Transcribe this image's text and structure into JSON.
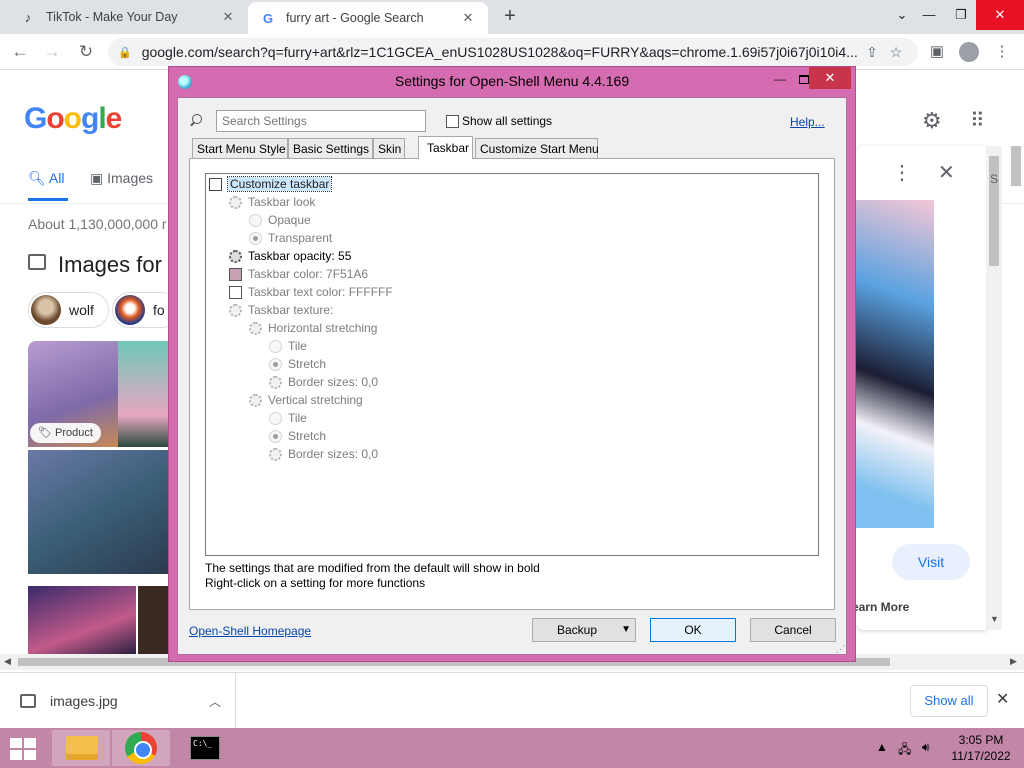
{
  "browser": {
    "tabs": [
      {
        "title": "TikTok - Make Your Day",
        "favicon": "tiktok-icon"
      },
      {
        "title": "furry art - Google Search",
        "favicon": "google-icon"
      }
    ],
    "url": "google.com/search?q=furry+art&rlz=1C1GCEA_enUS1028US1028&oq=FURRY&aqs=chrome.1.69i57j0i67j0i10i4..."
  },
  "google": {
    "logo": "Google",
    "tab_all": "All",
    "tab_images": "Images",
    "result_count": "About 1,130,000,000 r",
    "images_heading": "Images for",
    "chips": [
      "wolf",
      "fo"
    ],
    "product_badge": "Product",
    "side_panel": {
      "visit": "Visit",
      "learn_more": "earn More",
      "scroll_fragment": "S"
    }
  },
  "downloads": {
    "file": "images.jpg",
    "show_all": "Show all"
  },
  "taskbar": {
    "time": "3:05 PM",
    "date": "11/17/2022"
  },
  "dialog": {
    "title": "Settings for Open-Shell Menu 4.4.169",
    "search_placeholder": "Search Settings",
    "show_all_settings": "Show all settings",
    "help": "Help...",
    "tabs": [
      "Start Menu Style",
      "Basic Settings",
      "Skin",
      "Taskbar",
      "Customize Start Menu"
    ],
    "active_tab": "Taskbar",
    "tree": [
      {
        "label": "Customize taskbar",
        "type": "checkbox",
        "level": 0,
        "state": "focus"
      },
      {
        "label": "Taskbar look",
        "type": "gear",
        "level": 1,
        "state": "disabled"
      },
      {
        "label": "Opaque",
        "type": "radio",
        "level": 2,
        "state": "disabled"
      },
      {
        "label": "Transparent",
        "type": "radio-on",
        "level": 2,
        "state": "disabled"
      },
      {
        "label": "Taskbar opacity: 55",
        "type": "gear",
        "level": 1,
        "state": "bold"
      },
      {
        "label": "Taskbar color: 7F51A6",
        "type": "swatch",
        "level": 1,
        "state": "disabled",
        "color": "#c8a0b4"
      },
      {
        "label": "Taskbar text color: FFFFFF",
        "type": "swatch",
        "level": 1,
        "state": "disabled",
        "color": "#ffffff"
      },
      {
        "label": "Taskbar texture:",
        "type": "gear",
        "level": 1,
        "state": "disabled"
      },
      {
        "label": "Horizontal stretching",
        "type": "gear",
        "level": 2,
        "state": "disabled"
      },
      {
        "label": "Tile",
        "type": "radio",
        "level": 3,
        "state": "disabled"
      },
      {
        "label": "Stretch",
        "type": "radio-on",
        "level": 3,
        "state": "disabled"
      },
      {
        "label": "Border sizes: 0,0",
        "type": "gear",
        "level": 3,
        "state": "disabled"
      },
      {
        "label": "Vertical stretching",
        "type": "gear",
        "level": 2,
        "state": "disabled"
      },
      {
        "label": "Tile",
        "type": "radio",
        "level": 3,
        "state": "disabled"
      },
      {
        "label": "Stretch",
        "type": "radio-on",
        "level": 3,
        "state": "disabled"
      },
      {
        "label": "Border sizes: 0,0",
        "type": "gear",
        "level": 3,
        "state": "disabled"
      }
    ],
    "note_line1": "The settings that are modified from the default will show in bold",
    "note_line2": "Right-click on a setting for more functions",
    "homepage": "Open-Shell Homepage",
    "buttons": {
      "backup": "Backup",
      "ok": "OK",
      "cancel": "Cancel"
    }
  },
  "colors": {
    "dialog_frame": "#d56bb0",
    "taskbar": "#c287a6",
    "google_blue": "#1a73e8"
  }
}
